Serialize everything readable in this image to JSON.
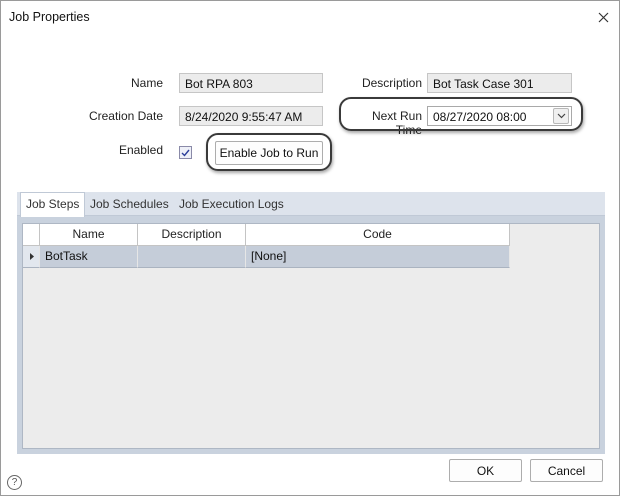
{
  "window": {
    "title": "Job Properties"
  },
  "form": {
    "name_label": "Name",
    "name_value": "Bot RPA 803",
    "description_label": "Description",
    "description_value": "Bot Task Case 301",
    "creation_date_label": "Creation Date",
    "creation_date_value": "8/24/2020 9:55:47 AM",
    "next_run_label": "Next Run Time",
    "next_run_value": "08/27/2020 08:00",
    "enabled_label": "Enabled",
    "enabled_checked": true,
    "enable_button_label": "Enable Job to Run"
  },
  "tabs": [
    {
      "label": "Job Steps",
      "active": true
    },
    {
      "label": "Job Schedules",
      "active": false
    },
    {
      "label": "Job Execution Logs",
      "active": false
    }
  ],
  "grid": {
    "columns": [
      "Name",
      "Description",
      "Code"
    ],
    "rows": [
      {
        "name": "BotTask",
        "description": "",
        "code": "[None]",
        "selected": true
      }
    ]
  },
  "footer": {
    "ok_label": "OK",
    "cancel_label": "Cancel",
    "help_glyph": "?"
  },
  "icons": {
    "close": "close-icon",
    "dropdown": "chevron-down-icon",
    "check": "checkmark-icon",
    "row_indicator": "row-pointer-icon",
    "help": "help-icon"
  },
  "colors": {
    "field_bg": "#ececec",
    "tab_area_bg": "#c9d2de",
    "selected_row_bg": "#c5cdd9",
    "highlight_outline": "#3a3a3a"
  }
}
